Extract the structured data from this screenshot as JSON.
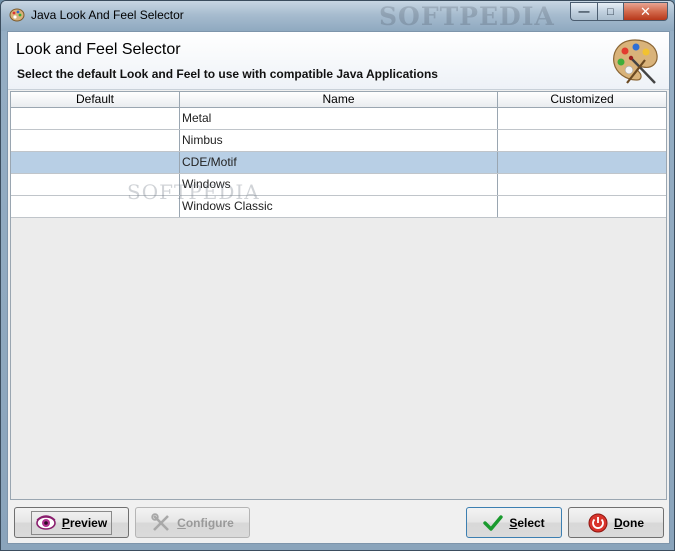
{
  "window": {
    "title": "Java Look And Feel Selector",
    "watermark": "SOFTPEDIA",
    "minimize_label": "—",
    "maximize_label": "□",
    "close_label": "✕"
  },
  "header": {
    "title": "Look and Feel Selector",
    "subtitle": "Select the default Look and Feel to use with compatible Java Applications",
    "icon": "palette-icon"
  },
  "table": {
    "columns": [
      "Default",
      "Name",
      "Customized"
    ],
    "rows": [
      {
        "default": "",
        "name": "Metal",
        "customized": ""
      },
      {
        "default": "",
        "name": "Nimbus",
        "customized": ""
      },
      {
        "default": "",
        "name": "CDE/Motif",
        "customized": ""
      },
      {
        "default": "",
        "name": "Windows",
        "customized": ""
      },
      {
        "default": "",
        "name": "Windows Classic",
        "customized": ""
      }
    ],
    "selected_index": 2,
    "watermark": "SOFTPEDIA"
  },
  "buttons": {
    "preview": {
      "mnemonic": "P",
      "rest": "review",
      "icon": "eye-icon"
    },
    "configure": {
      "mnemonic": "C",
      "rest": "onfigure",
      "icon": "tools-icon",
      "disabled": true
    },
    "select": {
      "mnemonic": "S",
      "rest": "elect",
      "icon": "checkmark-icon"
    },
    "done": {
      "mnemonic": "D",
      "rest": "one",
      "icon": "power-icon"
    }
  },
  "colors": {
    "selection": "#b8cfe5",
    "select_check": "#1a9a2e",
    "done_red": "#d8342c"
  }
}
